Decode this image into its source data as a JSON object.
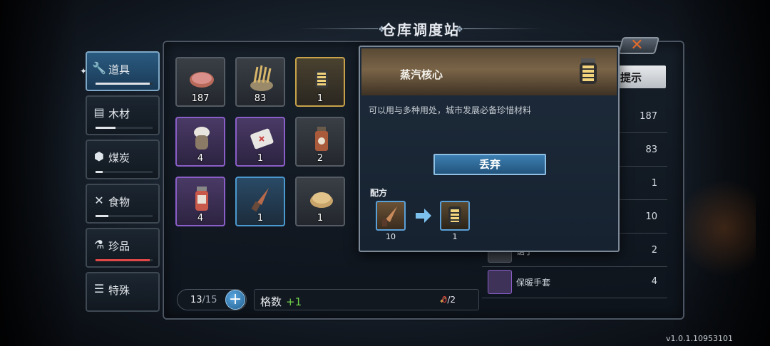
{
  "page": {
    "title": "仓库调度站",
    "version": "v1.0.1.10953101"
  },
  "colors": {
    "accent": "#3d7fb2",
    "close": "#e06a2c",
    "rare": "#8a5ec8",
    "epic_gold": "#c8a34a"
  },
  "sidebar": {
    "tabs": [
      {
        "label": "道具",
        "icon": "wrench-icon",
        "fill": 0.95
      },
      {
        "label": "木材",
        "icon": "logs-icon",
        "fill": 0.35
      },
      {
        "label": "煤炭",
        "icon": "coal-icon",
        "fill": 0.12
      },
      {
        "label": "食物",
        "icon": "fork-knife-icon",
        "fill": 0.22
      },
      {
        "label": "珍品",
        "icon": "flask-icon",
        "fill": 0.95
      },
      {
        "label": "特殊",
        "icon": "layers-icon",
        "fill": 0
      }
    ]
  },
  "grid": {
    "items": [
      {
        "name": "meat",
        "count": "187",
        "rarity": "normal"
      },
      {
        "name": "wheat-sack",
        "count": "83",
        "rarity": "normal"
      },
      {
        "name": "steam-core",
        "count": "1",
        "rarity": "gold"
      },
      {
        "name": "warm-gloves",
        "count": "4",
        "rarity": "purple"
      },
      {
        "name": "bandage",
        "count": "1",
        "rarity": "purple"
      },
      {
        "name": "medicine-bottle",
        "count": "2",
        "rarity": "normal"
      },
      {
        "name": "canister",
        "count": "4",
        "rarity": "purple"
      },
      {
        "name": "drill",
        "count": "1",
        "rarity": "blue"
      },
      {
        "name": "bread",
        "count": "1",
        "rarity": "normal"
      }
    ]
  },
  "capacity": {
    "used": "13",
    "total": "/15",
    "slot_label": "格数",
    "slot_plus": "+1",
    "drone_count": "0",
    "drone_total": "/2"
  },
  "popup": {
    "name": "蒸汽核心",
    "description": "可以用与多种用处，城市发展必备珍惜材料",
    "discard_label": "丢弃",
    "recipe_label": "配方",
    "recipe_in_count": "10",
    "recipe_out_count": "1"
  },
  "right_list": {
    "header": "提示",
    "rows": [
      {
        "name": "",
        "count": "187"
      },
      {
        "name": "",
        "count": "83"
      },
      {
        "name": "",
        "count": "1"
      },
      {
        "name": "",
        "count": "10"
      },
      {
        "name": "锯子",
        "count": "2"
      },
      {
        "name": "保暖手套",
        "count": "4"
      }
    ]
  }
}
